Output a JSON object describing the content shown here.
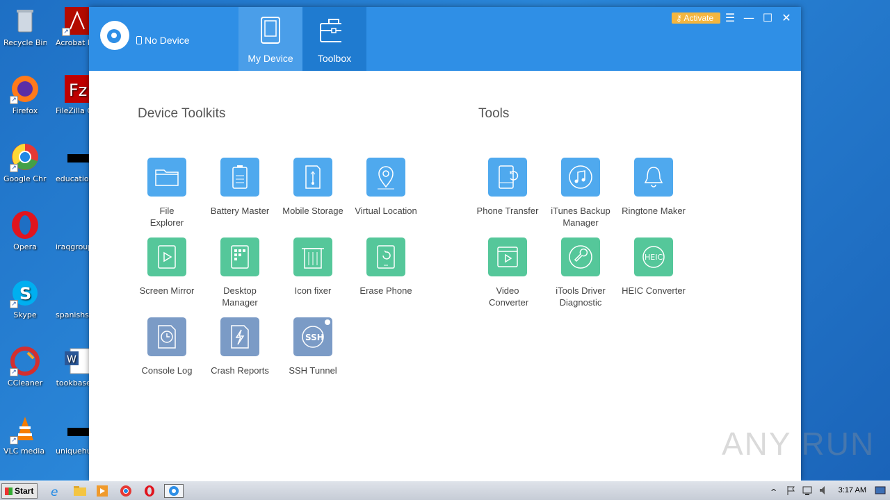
{
  "desktop": {
    "icons": [
      {
        "label": "Recycle Bin"
      },
      {
        "label": "Acrobat Reader DC"
      },
      {
        "label": "Firefox"
      },
      {
        "label": "FileZilla Client"
      },
      {
        "label": "Google Chrome"
      },
      {
        "label": "educationa..."
      },
      {
        "label": "Opera"
      },
      {
        "label": "iraqgroups..."
      },
      {
        "label": "Skype"
      },
      {
        "label": "spanishspe..."
      },
      {
        "label": "CCleaner"
      },
      {
        "label": "tookbase..."
      },
      {
        "label": "VLC media player"
      },
      {
        "label": "uniquehum..."
      }
    ]
  },
  "app": {
    "device_status": "No Device",
    "tabs": [
      {
        "label": "My Device"
      },
      {
        "label": "Toolbox"
      }
    ],
    "activate_label": "Activate",
    "sections": {
      "device_toolkits": {
        "title": "Device Toolkits",
        "items": [
          {
            "label": "File Explorer",
            "icon": "folder-icon"
          },
          {
            "label": "Battery Master",
            "icon": "battery-icon"
          },
          {
            "label": "Mobile Storage",
            "icon": "usb-icon"
          },
          {
            "label": "Virtual Location",
            "icon": "location-pin-icon"
          },
          {
            "label": "Screen Mirror",
            "icon": "play-icon"
          },
          {
            "label": "Desktop Manager",
            "icon": "grid-icon"
          },
          {
            "label": "Icon fixer",
            "icon": "trash-icon"
          },
          {
            "label": "Erase Phone",
            "icon": "erase-phone-icon"
          },
          {
            "label": "Console Log",
            "icon": "clock-icon"
          },
          {
            "label": "Crash Reports",
            "icon": "lightning-icon"
          },
          {
            "label": "SSH Tunnel",
            "icon": "ssh-icon",
            "badge": "SSH"
          }
        ]
      },
      "tools": {
        "title": "Tools",
        "items": [
          {
            "label": "Phone Transfer",
            "icon": "phone-transfer-icon"
          },
          {
            "label": "iTunes Backup Manager",
            "icon": "music-note-icon"
          },
          {
            "label": "Ringtone Maker",
            "icon": "bell-icon"
          },
          {
            "label": "Video Converter",
            "icon": "video-icon"
          },
          {
            "label": "iTools Driver Diagnostic",
            "icon": "wrench-icon"
          },
          {
            "label": "HEIC Converter",
            "icon": "heic-icon",
            "badge": "HEIC"
          }
        ]
      }
    }
  },
  "taskbar": {
    "start_label": "Start",
    "clock": "3:17 AM"
  },
  "watermark": "ANY RUN",
  "colors": {
    "header": "#2f8fe6",
    "tool_blue": "#4fa9ee",
    "tool_green": "#55c79a",
    "tool_slate": "#7b9bc6",
    "activate": "#f4b63f"
  }
}
